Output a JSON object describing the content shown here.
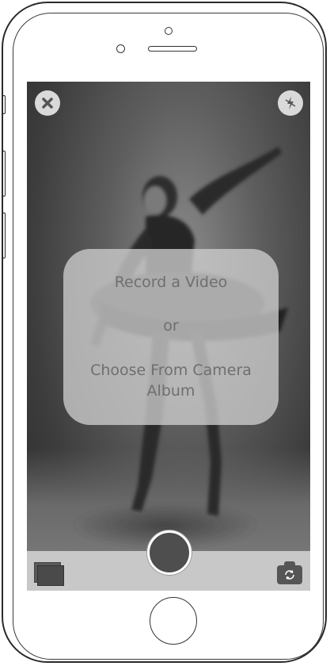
{
  "screen": {
    "dialog": {
      "record_label": "Record a Video",
      "or_label": "or",
      "album_label": "Choose From Camera Album"
    }
  },
  "icons": {
    "close": "close-icon",
    "flash": "flash-off-icon",
    "gallery": "gallery-icon",
    "switch_camera": "switch-camera-icon",
    "shutter": "shutter-button"
  },
  "colors": {
    "card_text": "#6f6f6f",
    "bottom_bar": "#c8c8c8",
    "shutter": "#4e4e4e"
  }
}
